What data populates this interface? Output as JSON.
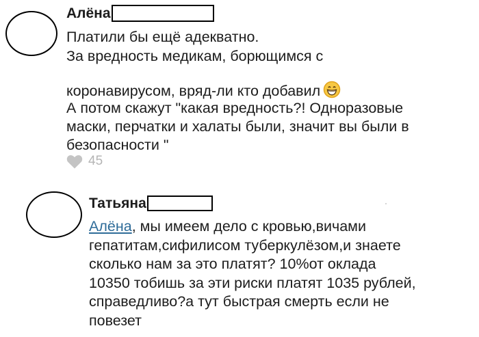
{
  "comments": [
    {
      "author": "Алёна",
      "lines": [
        "Платили бы ещё адекватно.",
        "За вредность медикам, борющимся с",
        "коронавирусом, вряд-ли кто добавил",
        "А потом скажут \"какая вредность?! Одноразовые",
        "маски, перчатки и халаты были, значит вы были в",
        "безопасности \""
      ],
      "emoji_icon": "grinning-face-emoji",
      "likes": "45"
    },
    {
      "author": "Татьяна",
      "mention": "Алёна",
      "first_line_rest": ", мы имеем дело с кровью,вичами",
      "lines": [
        "гепатитам,сифилисом туберкулёзом,и знаете",
        "сколько нам за это платят? 10%от оклада",
        "10350 тобишь за эти риски платят 1035 рублей,",
        "справедливо?а тут быстрая смерть если не",
        "повезет"
      ]
    }
  ],
  "colors": {
    "text": "#1c1c1c",
    "mention": "#2d6b98",
    "likes": "#b5b5b5"
  }
}
